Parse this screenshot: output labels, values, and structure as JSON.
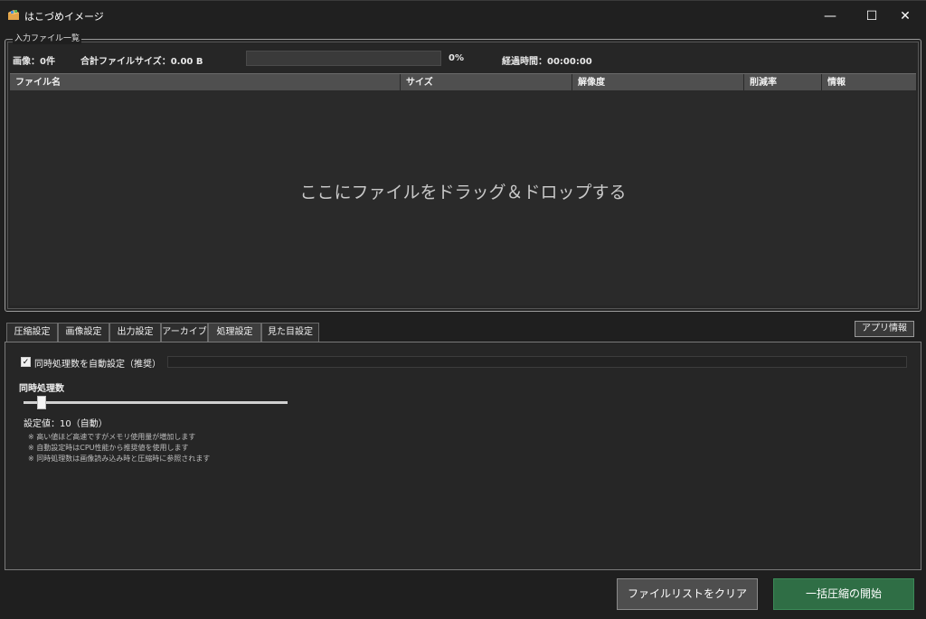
{
  "window": {
    "title": "はこづめイメージ",
    "minimize_icon": "—",
    "maximize_icon": "☐",
    "close_icon": "✕"
  },
  "file_list": {
    "group_title": "入力ファイル一覧",
    "image_count": "画像：0件",
    "total_size": "合計ファイルサイズ：0.00 B",
    "progress_percent": "0%",
    "progress_value": 0,
    "elapsed_time": "経過時間：00:00:00",
    "columns": [
      "ファイル名",
      "サイズ",
      "解像度",
      "削減率",
      "情報"
    ],
    "drop_hint": "ここにファイルをドラッグ＆ドロップする"
  },
  "tabs": [
    "圧縮設定",
    "画像設定",
    "出力設定",
    "アーカイブ",
    "処理設定",
    "見た目設定"
  ],
  "active_tab": "処理設定",
  "about_button": "アプリ情報",
  "processing": {
    "auto_checkbox_label": "同時処理数を自動設定（推奨）",
    "auto_checked": true,
    "concurrency_label": "同時処理数",
    "concurrency_value": 10,
    "setting_value_text": "設定値：10（自動）",
    "notes": [
      "※ 高い値ほど高速ですがメモリ使用量が増加します",
      "※ 自動設定時はCPU性能から推奨値を使用します",
      "※ 同時処理数は画像読み込み時と圧縮時に参照されます"
    ]
  },
  "footer": {
    "clear_button": "ファイルリストをクリア",
    "start_button": "一括圧縮の開始"
  },
  "colors": {
    "accent_green": "#2f6e45",
    "background": "#1f1f1f"
  }
}
